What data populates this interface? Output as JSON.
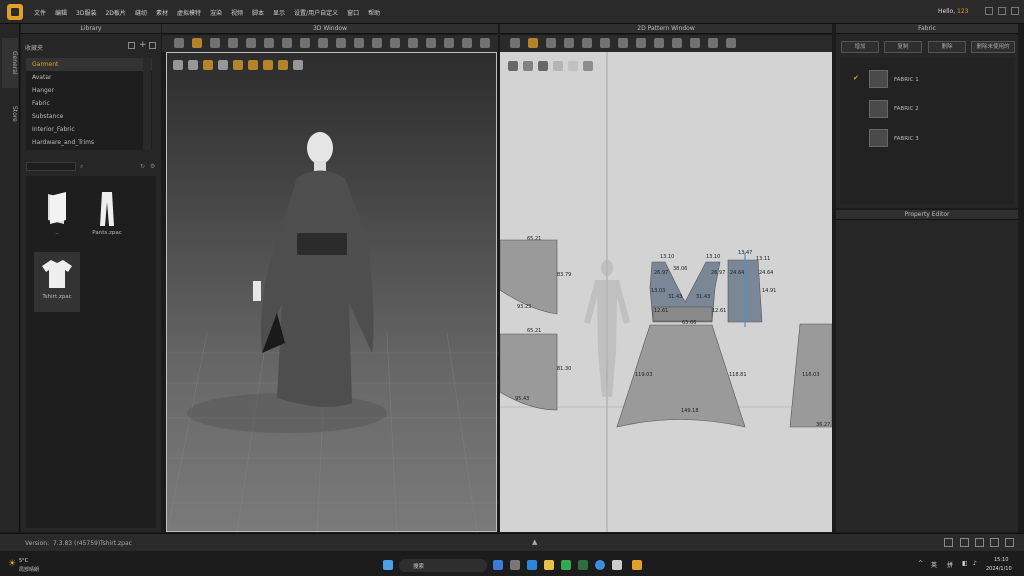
{
  "menubar": {
    "items": [
      "文件",
      "编辑",
      "3D服装",
      "2D板片",
      "缝纫",
      "素材",
      "虚拟模特",
      "渲染",
      "视频",
      "脚本",
      "显示",
      "设置/用户自定义",
      "窗口",
      "帮助"
    ],
    "greeting": "Hello,",
    "username": "123"
  },
  "vtabs": {
    "general": "General",
    "store": "Store"
  },
  "library": {
    "title": "Library",
    "favorites": "收藏夹",
    "tree": [
      "Garment",
      "Avatar",
      "Hanger",
      "Fabric",
      "Substance",
      "Interior_Fabric",
      "Hardware_and_Trims"
    ],
    "selected": "Garment",
    "items": [
      {
        "label": "..",
        "icon": "folder-icon"
      },
      {
        "label": "Pants.zpac",
        "icon": "pants-icon"
      },
      {
        "label": "Tshirt.zpac",
        "icon": "tshirt-icon"
      }
    ]
  },
  "win3d": {
    "title": "3D Window"
  },
  "win2d": {
    "title": "2D Pattern Window",
    "measurements": [
      "65.21",
      "83.79",
      "93.23",
      "65.21",
      "81.30",
      "95.43",
      "13.10",
      "38.06",
      "13.10",
      "26.97",
      "26.97",
      "13.03",
      "31.43",
      "31.43",
      "12.61",
      "12.61",
      "63.66",
      "119.03",
      "118.81",
      "149.18",
      "13.47",
      "13.11",
      "24.64",
      "24.64",
      "14.91",
      "116.03",
      "36.27"
    ]
  },
  "fabric": {
    "title": "Fabric",
    "buttons": [
      "增加",
      "复制",
      "删除",
      "删除未使用的"
    ],
    "items": [
      {
        "name": "FABRIC 1",
        "checked": true
      },
      {
        "name": "FABRIC 2",
        "checked": false
      },
      {
        "name": "FABRIC 3",
        "checked": false
      }
    ]
  },
  "property": {
    "title": "Property Editor"
  },
  "status": {
    "version_label": "Version:",
    "version": "7.3.83 (r45759)",
    "file": "Tshirt.zpac"
  },
  "taskbar": {
    "weather_temp": "5°C",
    "weather_text": "局部晴朗",
    "search": "搜索",
    "lang1": "英",
    "lang2": "拼",
    "time": "15:10",
    "date": "2024/1/10"
  },
  "colors": {
    "accent": "#e3a028",
    "bg": "#262626",
    "canvas2d": "#d3d3d3",
    "pattern": "#7a8796"
  }
}
